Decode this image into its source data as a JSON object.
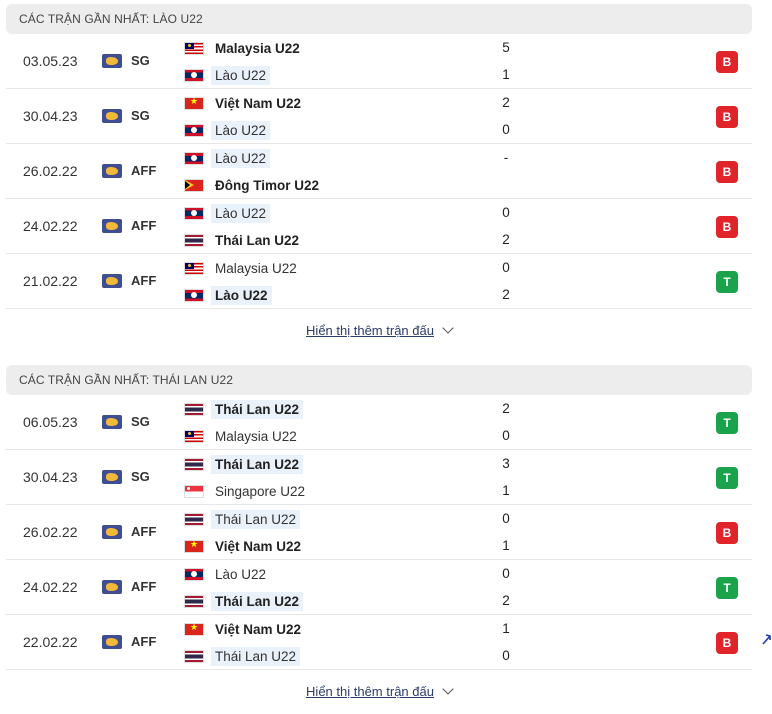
{
  "sections": [
    {
      "title": "CÁC TRẬN GẦN NHẤT: LÀO U22",
      "more_label": "Hiển thị thêm trận đấu",
      "matches": [
        {
          "date": "03.05.23",
          "competition": "SG",
          "home": {
            "name": "Malaysia U22",
            "flag": "my",
            "bold": true,
            "hl": false
          },
          "away": {
            "name": "Lào U22",
            "flag": "la",
            "bold": false,
            "hl": true
          },
          "home_score": "5",
          "away_score": "1",
          "result": "B"
        },
        {
          "date": "30.04.23",
          "competition": "SG",
          "home": {
            "name": "Việt Nam U22",
            "flag": "vn",
            "bold": true,
            "hl": false
          },
          "away": {
            "name": "Lào U22",
            "flag": "la",
            "bold": false,
            "hl": true
          },
          "home_score": "2",
          "away_score": "0",
          "result": "B"
        },
        {
          "date": "26.02.22",
          "competition": "AFF",
          "home": {
            "name": "Lào U22",
            "flag": "la",
            "bold": false,
            "hl": true
          },
          "away": {
            "name": "Đông Timor U22",
            "flag": "tl",
            "bold": true,
            "hl": false
          },
          "home_score": "-",
          "away_score": "",
          "result": "B"
        },
        {
          "date": "24.02.22",
          "competition": "AFF",
          "home": {
            "name": "Lào U22",
            "flag": "la",
            "bold": false,
            "hl": true
          },
          "away": {
            "name": "Thái Lan U22",
            "flag": "th",
            "bold": true,
            "hl": false
          },
          "home_score": "0",
          "away_score": "2",
          "result": "B"
        },
        {
          "date": "21.02.22",
          "competition": "AFF",
          "home": {
            "name": "Malaysia U22",
            "flag": "my",
            "bold": false,
            "hl": false
          },
          "away": {
            "name": "Lào U22",
            "flag": "la",
            "bold": true,
            "hl": true
          },
          "home_score": "0",
          "away_score": "2",
          "result": "T"
        }
      ]
    },
    {
      "title": "CÁC TRẬN GẦN NHẤT: THÁI LAN U22",
      "more_label": "Hiển thị thêm trận đấu",
      "matches": [
        {
          "date": "06.05.23",
          "competition": "SG",
          "home": {
            "name": "Thái Lan U22",
            "flag": "th",
            "bold": true,
            "hl": true
          },
          "away": {
            "name": "Malaysia U22",
            "flag": "my",
            "bold": false,
            "hl": false
          },
          "home_score": "2",
          "away_score": "0",
          "result": "T"
        },
        {
          "date": "30.04.23",
          "competition": "SG",
          "home": {
            "name": "Thái Lan U22",
            "flag": "th",
            "bold": true,
            "hl": true
          },
          "away": {
            "name": "Singapore U22",
            "flag": "sg",
            "bold": false,
            "hl": false
          },
          "home_score": "3",
          "away_score": "1",
          "result": "T"
        },
        {
          "date": "26.02.22",
          "competition": "AFF",
          "home": {
            "name": "Thái Lan U22",
            "flag": "th",
            "bold": false,
            "hl": true
          },
          "away": {
            "name": "Việt Nam U22",
            "flag": "vn",
            "bold": true,
            "hl": false
          },
          "home_score": "0",
          "away_score": "1",
          "result": "B"
        },
        {
          "date": "24.02.22",
          "competition": "AFF",
          "home": {
            "name": "Lào U22",
            "flag": "la",
            "bold": false,
            "hl": false
          },
          "away": {
            "name": "Thái Lan U22",
            "flag": "th",
            "bold": true,
            "hl": true
          },
          "home_score": "0",
          "away_score": "2",
          "result": "T"
        },
        {
          "date": "22.02.22",
          "competition": "AFF",
          "home": {
            "name": "Việt Nam U22",
            "flag": "vn",
            "bold": true,
            "hl": false
          },
          "away": {
            "name": "Thái Lan U22",
            "flag": "th",
            "bold": false,
            "hl": true
          },
          "home_score": "1",
          "away_score": "0",
          "result": "B"
        }
      ]
    }
  ],
  "icons": {
    "competition": "world-map-icon",
    "more": "chevron-down-icon"
  }
}
